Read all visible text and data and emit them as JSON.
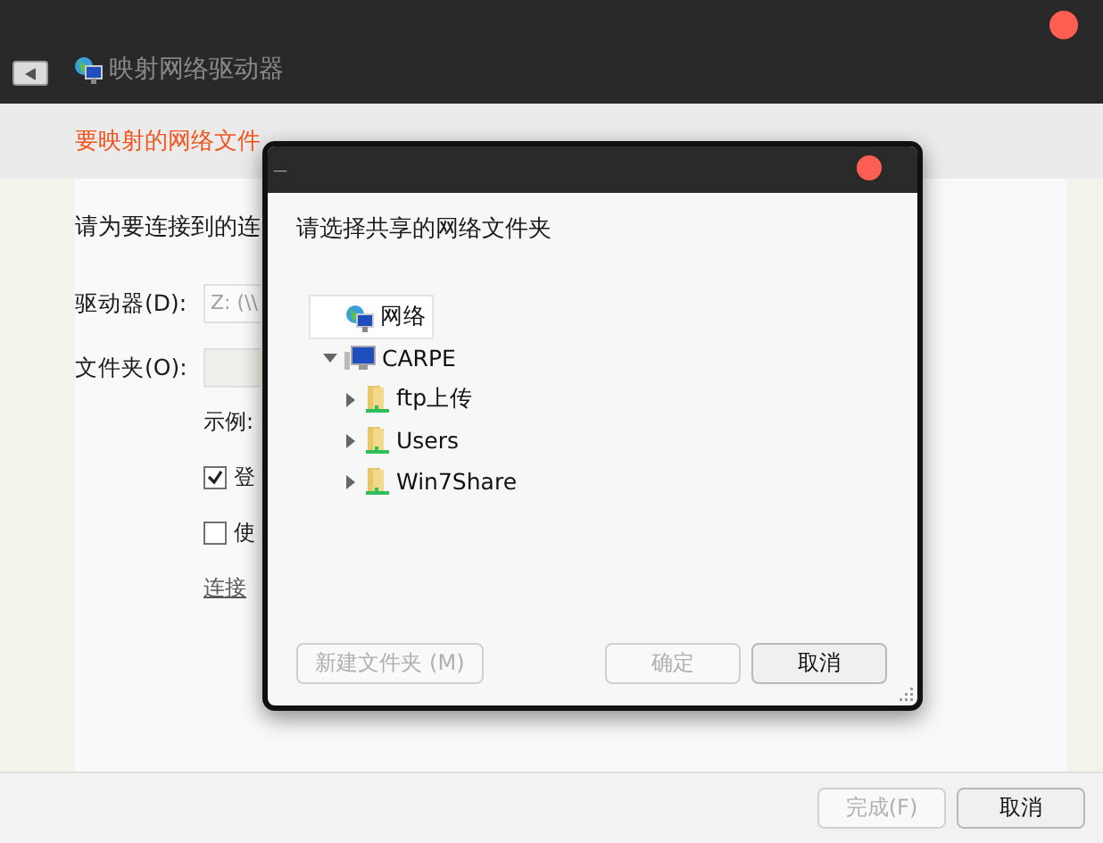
{
  "window": {
    "title": "映射网络驱动器"
  },
  "heading": "要映射的网络文件",
  "instruction": "请为要连接到的连",
  "fields": [
    {
      "label": "驱动器(D):",
      "value": "Z: (\\\\"
    },
    {
      "label": "文件夹(O):"
    }
  ],
  "example": "示例:",
  "checkboxes": [
    {
      "label": "登",
      "checked": true
    },
    {
      "label": "使",
      "checked": false
    }
  ],
  "link": "连接",
  "buttons": [
    {
      "label": "完成(F)",
      "disabled": true
    },
    {
      "label": "取消",
      "disabled": false
    }
  ],
  "dialog": {
    "title": "—",
    "prompt": "请选择共享的网络文件夹",
    "tree": [
      {
        "label": "网络",
        "kind": "network",
        "selected": true
      },
      {
        "label": "CARPE",
        "kind": "computer",
        "selected": false,
        "expanded": true,
        "children": [
          {
            "label": "ftp上传",
            "kind": "share",
            "selected": false,
            "expanded": false
          },
          {
            "label": "Users",
            "kind": "share",
            "selected": false,
            "expanded": false
          },
          {
            "label": "Win7Share",
            "kind": "share",
            "selected": false,
            "expanded": false
          }
        ]
      }
    ],
    "buttons": [
      {
        "label": "新建文件夹 (M)",
        "disabled": true
      },
      {
        "label": "确定",
        "disabled": true
      },
      {
        "label": "取消",
        "disabled": false
      }
    ]
  }
}
